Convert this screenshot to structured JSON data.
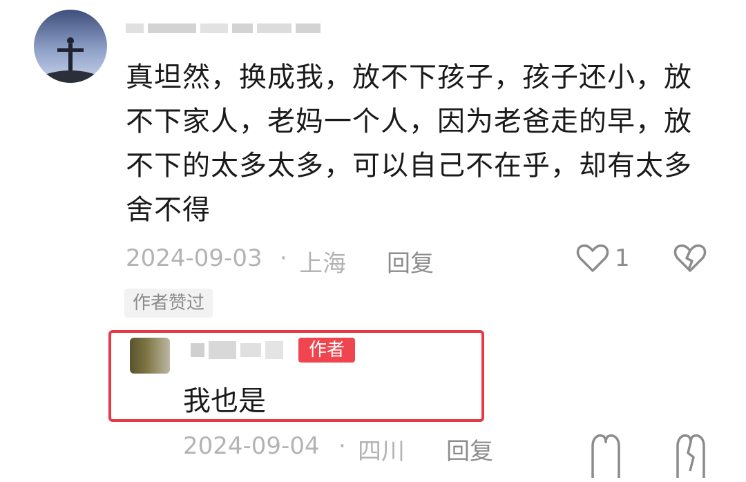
{
  "comment": {
    "text": "真坦然，换成我，放不下孩子，孩子还小，放不下家人，老妈一个人，因为老爸走的早，放不下的太多太多，可以自己不在乎，却有太多舍不得",
    "date": "2024-09-03",
    "location": "上海",
    "separator": "·",
    "reply_label": "回复",
    "like_count": "1",
    "author_liked_tag": "作者赞过"
  },
  "reply": {
    "author_badge": "作者",
    "text": "我也是",
    "date": "2024-09-04",
    "location": "四川",
    "separator": "·",
    "reply_label": "回复"
  },
  "colors": {
    "highlight": "#e53a44",
    "badge": "#f0444e",
    "meta": "#b3b3b3"
  },
  "icons": [
    "heart-icon",
    "dislike-icon"
  ]
}
